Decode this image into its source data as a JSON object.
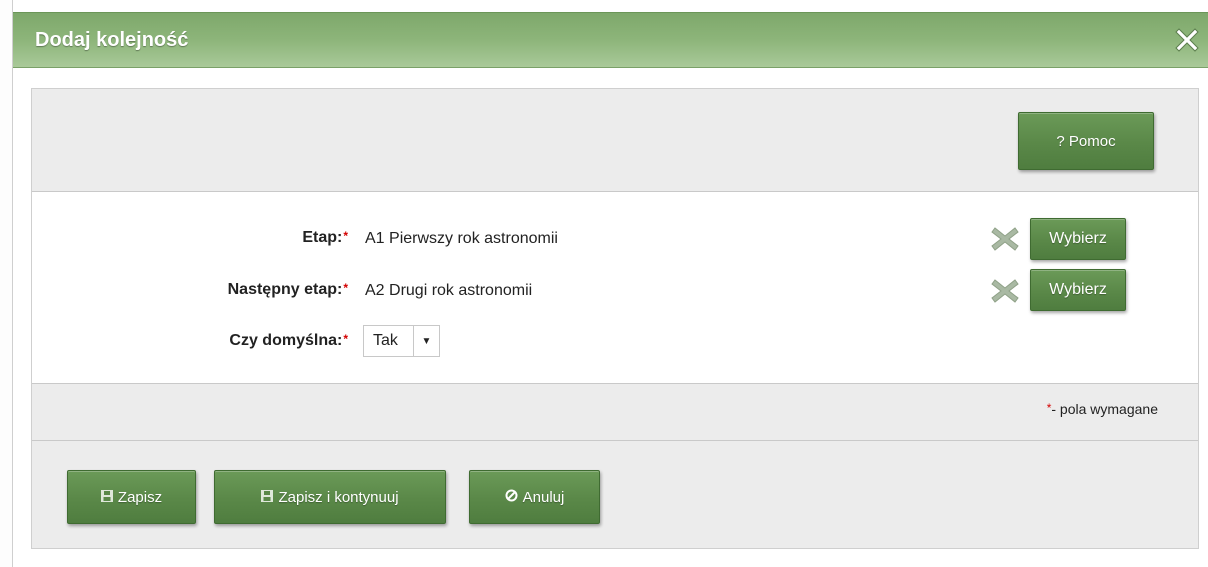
{
  "dialog": {
    "title": "Dodaj kolejność",
    "close_icon": "close-icon"
  },
  "toolbar": {
    "help_label": "? Pomoc"
  },
  "form": {
    "required_mark": "*",
    "fields": [
      {
        "label": "Etap:",
        "value": "A1 Pierwszy rok astronomii",
        "choose_label": "Wybierz",
        "clear_icon": "clear-icon"
      },
      {
        "label": "Następny etap:",
        "value": "A2 Drugi rok astronomii",
        "choose_label": "Wybierz",
        "clear_icon": "clear-icon"
      },
      {
        "label": "Czy domyślna:",
        "select_value": "Tak"
      }
    ]
  },
  "legend": {
    "mark": "*",
    "text": "- pola wymagane"
  },
  "actions": {
    "save_label": "Zapisz",
    "save_continue_label": "Zapisz i kontynuuj",
    "cancel_label": "Anuluj",
    "save_icon": "save-icon",
    "cancel_icon": "cancel-icon"
  },
  "colors": {
    "titlebar": "#8db57a",
    "button": "#5a8848",
    "required": "#d40000"
  }
}
